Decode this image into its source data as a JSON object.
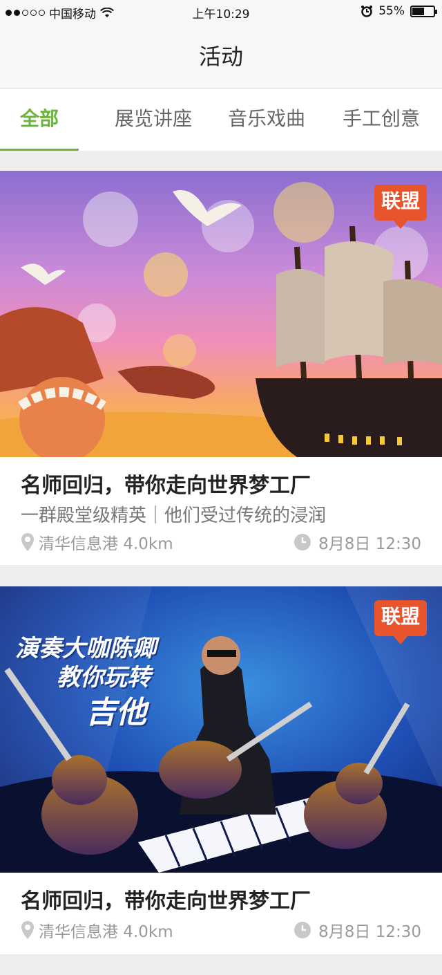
{
  "status_bar": {
    "carrier": "中国移动",
    "time": "上午10:29",
    "battery": "55%",
    "battery_level": 0.55
  },
  "nav": {
    "title": "活动"
  },
  "tabs": [
    {
      "label": "全部",
      "active": true
    },
    {
      "label": "展览讲座",
      "active": false
    },
    {
      "label": "音乐戏曲",
      "active": false
    },
    {
      "label": "手工创意",
      "active": false
    }
  ],
  "cards": [
    {
      "badge": "联盟",
      "title": "名师回归，带你走向世界梦工厂",
      "subtitle": "一群殿堂级精英｜他们受过传统的浸润",
      "location": "清华信息港 4.0km",
      "datetime": "8月8日 12:30"
    },
    {
      "badge": "联盟",
      "poster_lines": [
        "演奏大咖陈卿",
        "教你玩转",
        "吉他"
      ],
      "title": "名师回归，带你走向世界梦工厂",
      "location": "清华信息港 4.0km",
      "datetime": "8月8日 12:30"
    }
  ],
  "colors": {
    "accent": "#6cb33f",
    "badge": "#e8542c"
  }
}
